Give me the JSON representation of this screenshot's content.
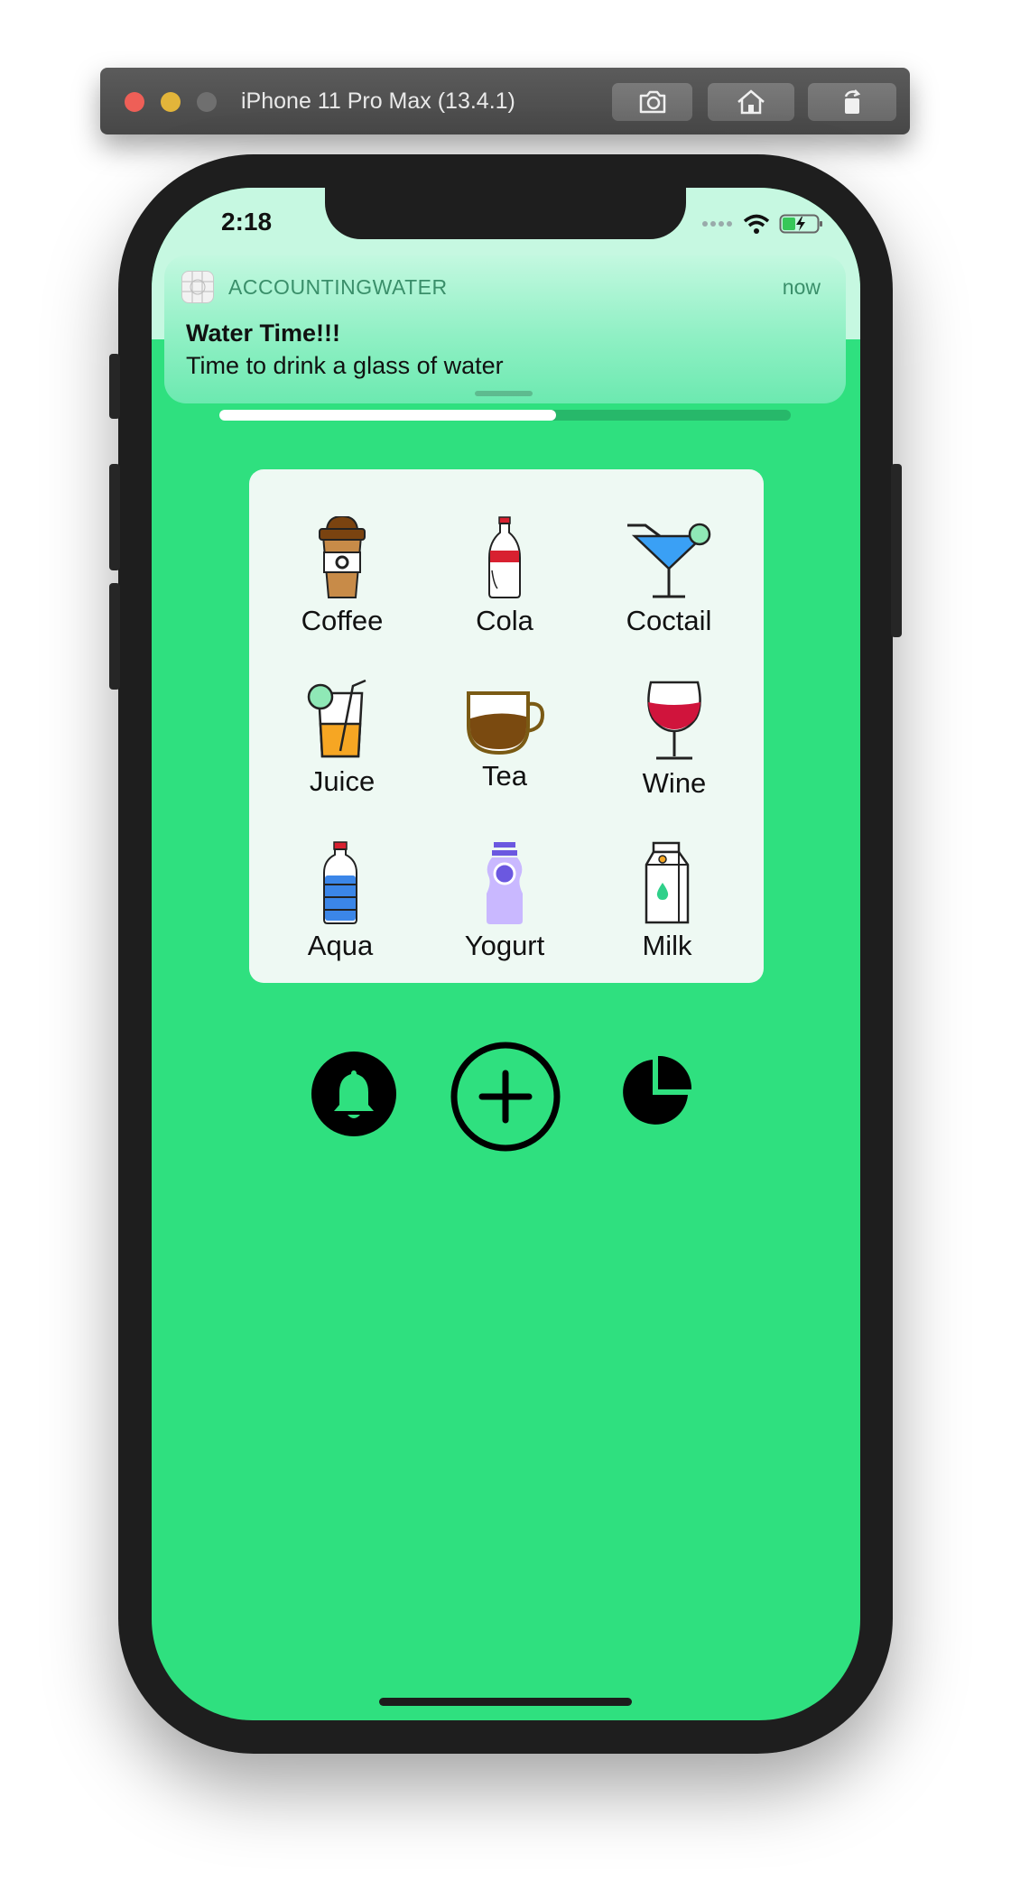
{
  "simulator": {
    "title": "iPhone 11 Pro Max (13.4.1)",
    "buttons": [
      "camera-icon",
      "home-icon",
      "rotate-icon"
    ]
  },
  "status_bar": {
    "time": "2:18"
  },
  "notification": {
    "app_name": "ACCOUNTINGWATER",
    "time": "now",
    "title": "Water Time!!!",
    "body": "Time to drink a glass of water"
  },
  "progress": {
    "value": 0.59
  },
  "drinks": [
    {
      "label": "Coffee",
      "icon": "coffee-cup-icon"
    },
    {
      "label": "Cola",
      "icon": "cola-bottle-icon"
    },
    {
      "label": "Coctail",
      "icon": "cocktail-glass-icon"
    },
    {
      "label": "Juice",
      "icon": "juice-glass-icon"
    },
    {
      "label": "Tea",
      "icon": "tea-cup-icon"
    },
    {
      "label": "Wine",
      "icon": "wine-glass-icon"
    },
    {
      "label": "Aqua",
      "icon": "water-bottle-icon"
    },
    {
      "label": "Yogurt",
      "icon": "yogurt-bottle-icon"
    },
    {
      "label": "Milk",
      "icon": "milk-carton-icon"
    }
  ],
  "actions": [
    "bell-icon",
    "add-icon",
    "pie-chart-icon"
  ],
  "colors": {
    "background": "#2fe07f",
    "card": "#eef9f3",
    "progress_fill": "#ffffff",
    "progress_track": "#27b86a"
  }
}
